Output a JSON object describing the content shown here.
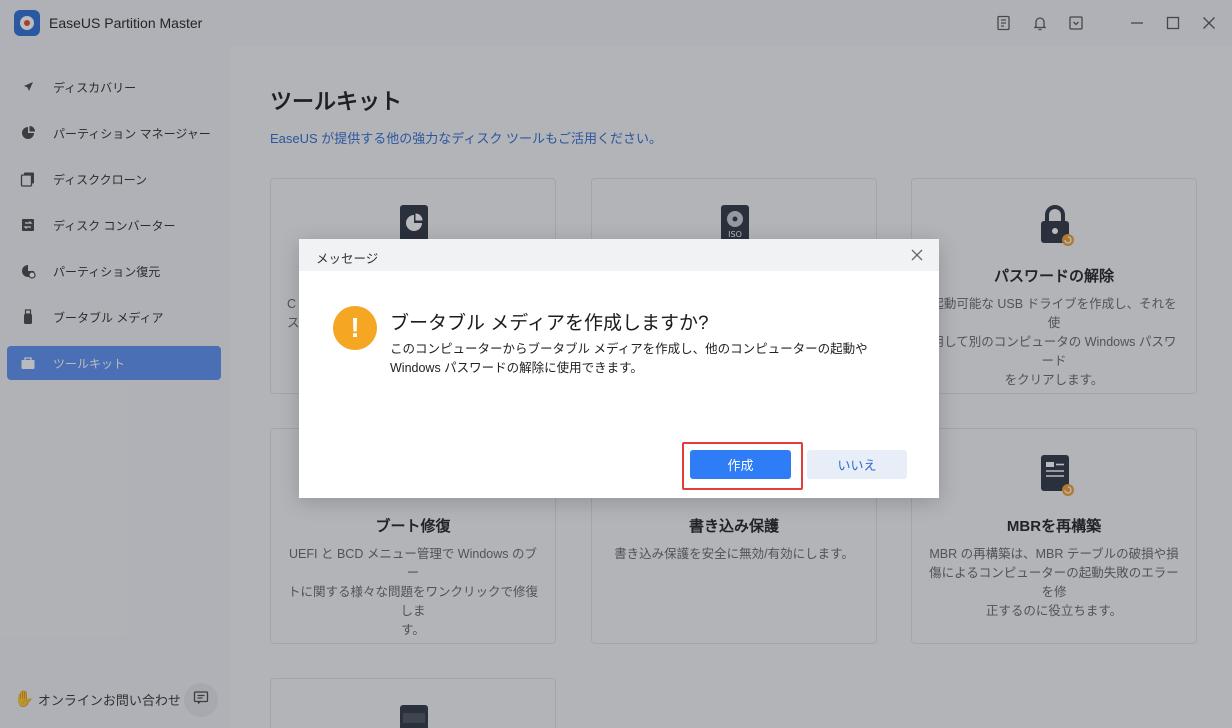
{
  "app": {
    "title": "EaseUS Partition Master"
  },
  "sidebar": {
    "items": [
      {
        "label": "ディスカバリー",
        "icon": "compass-icon"
      },
      {
        "label": "パーティション マネージャー",
        "icon": "pie-chart-icon"
      },
      {
        "label": "ディスククローン",
        "icon": "clone-icon"
      },
      {
        "label": "ディスク コンバーター",
        "icon": "convert-icon"
      },
      {
        "label": "パーティション復元",
        "icon": "restore-icon"
      },
      {
        "label": "ブータブル メディア",
        "icon": "usb-icon"
      },
      {
        "label": "ツールキット",
        "icon": "toolkit-icon",
        "active": true
      }
    ],
    "online_label": "オンラインお問い合わせ"
  },
  "main": {
    "title": "ツールキット",
    "subtitle": "EaseUS が提供する他の強力なディスク ツールもご活用ください。",
    "cards": [
      {
        "title": "",
        "desc": "C\nス",
        "icon": "disk-pie-icon"
      },
      {
        "title": "",
        "desc": "",
        "icon": "iso-icon"
      },
      {
        "title": "パスワードの解除",
        "desc": "起動可能な USB ドライブを作成し、それを使\n用して別のコンピュータの Windows パスワード\nをクリアします。",
        "icon": "lock-icon"
      },
      {
        "title": "ブート修復",
        "desc": "UEFI と BCD メニュー管理で Windows のブー\nトに関する様々な問題をワンクリックで修復しま\nす。",
        "icon": "boot-repair-icon"
      },
      {
        "title": "書き込み保護",
        "desc": "書き込み保護を安全に無効/有効にします。",
        "icon": "write-protect-icon"
      },
      {
        "title": "MBRを再構築",
        "desc": "MBR の再構築は、MBR テーブルの破損や損\n傷によるコンピューターの起動失敗のエラーを修\n正するのに役立ちます。",
        "icon": "mbr-icon"
      }
    ]
  },
  "dialog": {
    "title": "メッセージ",
    "heading": "ブータブル メディアを作成しますか?",
    "body": "このコンピューターからブータブル メディアを作成し、他のコンピューターの起動や Windows パスワードの解除に使用できます。",
    "confirm_label": "作成",
    "cancel_label": "いいえ"
  },
  "colors": {
    "accent": "#2e7cf6",
    "highlight": "#e43b3b",
    "warning": "#f5a623",
    "sidebar_active": "#5b8ff0"
  }
}
